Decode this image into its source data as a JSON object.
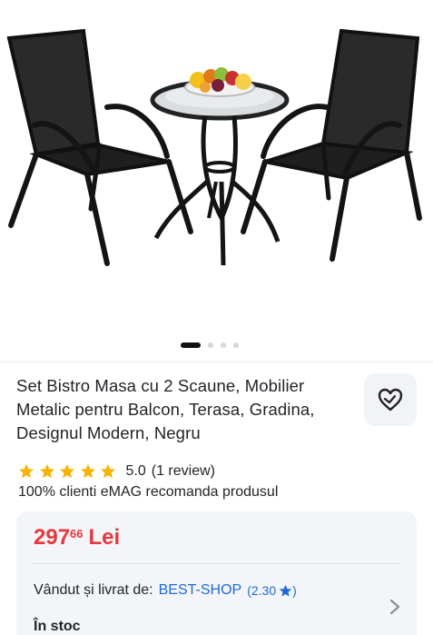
{
  "gallery": {
    "image_alt": "Set Bistro Masa cu 2 Scaune",
    "dots_total": 4,
    "active_dot": 0
  },
  "product": {
    "title": "Set Bistro Masa cu 2 Scaune, Mobilier Metalic pentru Balcon, Terasa, Gradina, Designul Modern, Negru",
    "rating": "5.0",
    "review_text": "(1 review)",
    "stars": 5,
    "recommend_text": "100% clienti eMAG recomanda produsul"
  },
  "offer": {
    "price_main": "297",
    "price_decimals": "66",
    "currency": "Lei",
    "seller_label": "Vândut și livrat de:",
    "seller_name": "BEST-SHOP",
    "seller_score": "(2.30",
    "seller_score_close": ")",
    "stock_text": "În stoc"
  },
  "colors": {
    "price": "#e8383d",
    "link": "#1e6ad6",
    "star": "#f6b400",
    "card_bg": "#f3f5f8"
  },
  "icons": {
    "favorite": "heart-outline-icon",
    "chevron": "chevron-right-icon",
    "seller_star": "star-icon"
  }
}
